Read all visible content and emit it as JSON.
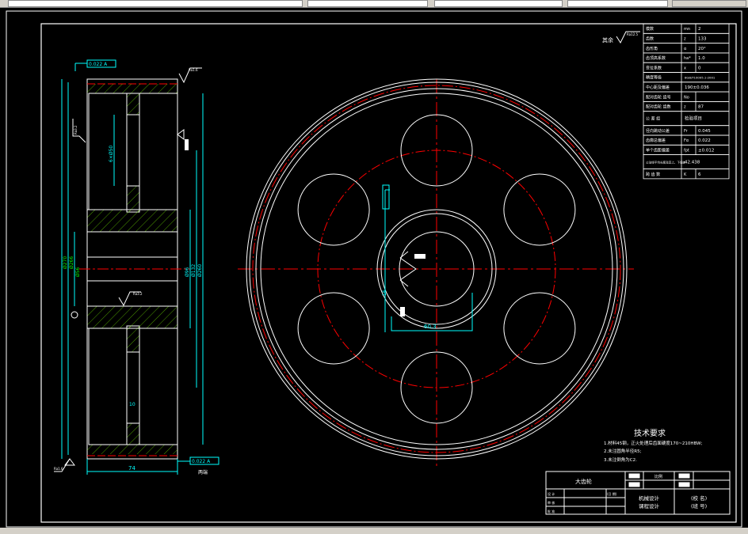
{
  "colors": {
    "background": "#000000",
    "outline": "#ffffff",
    "dimension": "#00ffff",
    "centerline": "#ff0000",
    "hatch": "#7fff00"
  },
  "surface_note": {
    "label": "其余",
    "roughness": "Ra12.5"
  },
  "gear_table": [
    {
      "name": "模数",
      "symbol": "mn",
      "value": "2"
    },
    {
      "name": "齿数",
      "symbol": "z",
      "value": "133"
    },
    {
      "name": "齿形角",
      "symbol": "α",
      "value": "20°"
    },
    {
      "name": "齿顶高系数",
      "symbol": "ha*",
      "value": "1.0"
    },
    {
      "name": "变位系数",
      "symbol": "x",
      "value": "0"
    },
    {
      "name": "精度等级",
      "symbol": "",
      "value": "8GB/T10095.1-2001"
    },
    {
      "name": "中心距及偏差",
      "symbol": "",
      "value": "190±0.036"
    },
    {
      "name": "配对齿轮 齿号",
      "symbol": "No",
      "value": ""
    },
    {
      "name": "配对齿轮 齿数",
      "symbol": "z",
      "value": "87"
    },
    {
      "name": "公 差 组",
      "symbol": "",
      "value": "检验项目"
    },
    {
      "name": "径向跳动公差",
      "symbol": "Fr",
      "value": "0.045"
    },
    {
      "name": "齿廓总偏差",
      "symbol": "Fα",
      "value": "0.022"
    },
    {
      "name": "单个齿距偏差",
      "symbol": "fpt",
      "value": "±0.012"
    },
    {
      "name": "公法线平均长度及其上、下偏差",
      "symbol": "",
      "value": "42.438"
    },
    {
      "name": "跨 齿 数",
      "symbol": "K",
      "value": "6"
    }
  ],
  "tech_requirements": {
    "title": "技术要求",
    "items": [
      "1.材料45钢，正火处理后齿面硬度170~210HBW;",
      "2.未注圆角半径R5;",
      "3.未注倒角为C2."
    ]
  },
  "title_block": {
    "part_name": "大齿轮",
    "scale_label": "比例",
    "rows": [
      "设 计",
      "审 核",
      "批 准"
    ],
    "date_label": "(日 期)",
    "course": [
      "机械设计",
      "课程设计"
    ],
    "school": [
      "(校 名)",
      "(班 号)"
    ]
  },
  "side_view": {
    "width_dim": "74",
    "web_dim": "10",
    "bore_dims": [
      "Ø56",
      "Ø96",
      "Ø132",
      "Ø260"
    ],
    "outer_dims": [
      "Ø270",
      "Ø266"
    ],
    "hub_dims": [
      "Ø56"
    ],
    "runout_top": "0.022 A",
    "runout_bottom": "0.022 A",
    "datum_note": "两端",
    "roughness_marks": [
      "Ra1.6",
      "Ra3.2",
      "Ra1.6",
      "Ra3.2"
    ],
    "hole_dim": "6×Ø50"
  },
  "front_view": {
    "keyway_width": "16",
    "keyway_depth": "60.3"
  }
}
